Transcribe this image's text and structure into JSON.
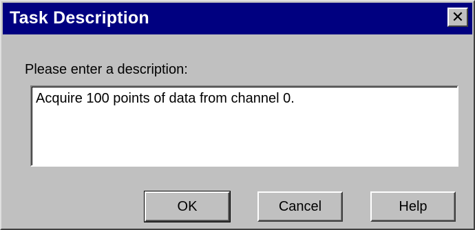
{
  "window": {
    "title": "Task Description",
    "close_glyph": "✕"
  },
  "form": {
    "prompt_label": "Please enter a description:",
    "description_value": "Acquire 100 points of data from channel 0."
  },
  "buttons": {
    "ok_label": "OK",
    "cancel_label": "Cancel",
    "help_label": "Help"
  },
  "colors": {
    "titlebar": "#000080",
    "face": "#c0c0c0"
  }
}
